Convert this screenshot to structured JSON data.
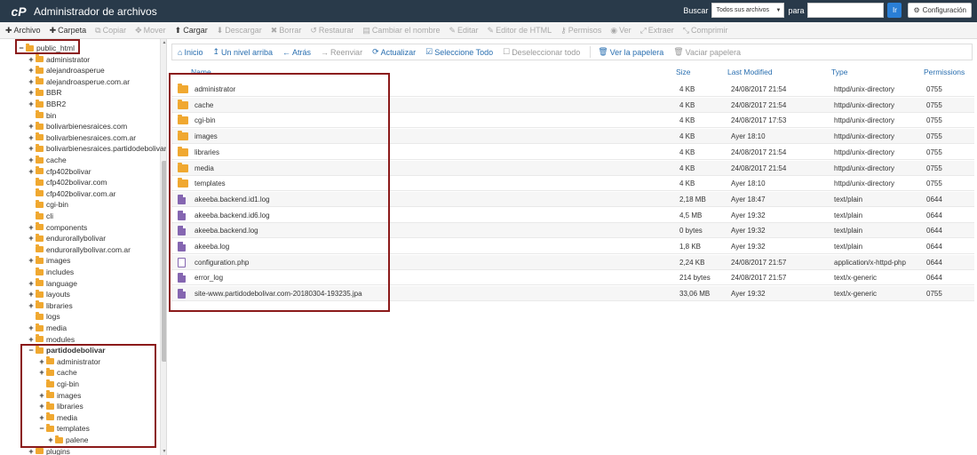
{
  "header": {
    "title": "Administrador de archivos",
    "search_label": "Buscar",
    "search_scope": "Todos sus archivos",
    "for_label": "para",
    "go_label": "Ir",
    "settings_label": "Configuración"
  },
  "toolbar": [
    {
      "label": "Archivo",
      "icon": "plus",
      "enabled": true
    },
    {
      "label": "Carpeta",
      "icon": "plus",
      "enabled": true
    },
    {
      "label": "Copiar",
      "icon": "copy",
      "enabled": false
    },
    {
      "label": "Mover",
      "icon": "move",
      "enabled": false
    },
    {
      "label": "Cargar",
      "icon": "upload",
      "enabled": true
    },
    {
      "label": "Descargar",
      "icon": "download",
      "enabled": false
    },
    {
      "label": "Borrar",
      "icon": "times",
      "enabled": false
    },
    {
      "label": "Restaurar",
      "icon": "undo",
      "enabled": false
    },
    {
      "label": "Cambiar el nombre",
      "icon": "file",
      "enabled": false
    },
    {
      "label": "Editar",
      "icon": "pencil",
      "enabled": false
    },
    {
      "label": "Editor de HTML",
      "icon": "pencil",
      "enabled": false
    },
    {
      "label": "Permisos",
      "icon": "key",
      "enabled": false
    },
    {
      "label": "Ver",
      "icon": "eye",
      "enabled": false
    },
    {
      "label": "Extraer",
      "icon": "expand",
      "enabled": false
    },
    {
      "label": "Comprimir",
      "icon": "compress",
      "enabled": false
    }
  ],
  "nav": [
    {
      "label": "Inicio",
      "icon": "home",
      "enabled": true
    },
    {
      "label": "Un nivel arriba",
      "icon": "level-up",
      "enabled": true
    },
    {
      "label": "Atrás",
      "icon": "arrow-left",
      "enabled": true
    },
    {
      "label": "Reenviar",
      "icon": "arrow-right",
      "enabled": false
    },
    {
      "label": "Actualizar",
      "icon": "refresh",
      "enabled": true
    },
    {
      "label": "Seleccione Todo",
      "icon": "check-square",
      "enabled": true
    },
    {
      "label": "Deseleccionar todo",
      "icon": "square",
      "enabled": false
    },
    {
      "label": "Ver la papelera",
      "icon": "trash",
      "enabled": true
    },
    {
      "label": "Vaciar papelera",
      "icon": "trash",
      "enabled": false
    }
  ],
  "tree": [
    {
      "label": "public_html",
      "toggle": "−",
      "indent": 1,
      "bold": false
    },
    {
      "label": "administrator",
      "toggle": "+",
      "indent": 2
    },
    {
      "label": "alejandroasperue",
      "toggle": "+",
      "indent": 2
    },
    {
      "label": "alejandroasperue.com.ar",
      "toggle": "+",
      "indent": 2
    },
    {
      "label": "BBR",
      "toggle": "+",
      "indent": 2
    },
    {
      "label": "BBR2",
      "toggle": "+",
      "indent": 2
    },
    {
      "label": "bin",
      "toggle": "",
      "indent": 2
    },
    {
      "label": "bolivarbienesraices.com",
      "toggle": "+",
      "indent": 2
    },
    {
      "label": "bolivarbienesraices.com.ar",
      "toggle": "+",
      "indent": 2
    },
    {
      "label": "bolivarbienesraices.partidodebolivar.",
      "toggle": "+",
      "indent": 2
    },
    {
      "label": "cache",
      "toggle": "+",
      "indent": 2
    },
    {
      "label": "cfp402bolivar",
      "toggle": "+",
      "indent": 2
    },
    {
      "label": "cfp402bolivar.com",
      "toggle": "",
      "indent": 2
    },
    {
      "label": "cfp402bolivar.com.ar",
      "toggle": "",
      "indent": 2
    },
    {
      "label": "cgi-bin",
      "toggle": "",
      "indent": 2
    },
    {
      "label": "cli",
      "toggle": "",
      "indent": 2
    },
    {
      "label": "components",
      "toggle": "+",
      "indent": 2
    },
    {
      "label": "endurorallybolivar",
      "toggle": "+",
      "indent": 2
    },
    {
      "label": "endurorallybolivar.com.ar",
      "toggle": "",
      "indent": 2
    },
    {
      "label": "images",
      "toggle": "+",
      "indent": 2
    },
    {
      "label": "includes",
      "toggle": "",
      "indent": 2
    },
    {
      "label": "language",
      "toggle": "+",
      "indent": 2
    },
    {
      "label": "layouts",
      "toggle": "+",
      "indent": 2
    },
    {
      "label": "libraries",
      "toggle": "+",
      "indent": 2
    },
    {
      "label": "logs",
      "toggle": "",
      "indent": 2
    },
    {
      "label": "media",
      "toggle": "+",
      "indent": 2
    },
    {
      "label": "modules",
      "toggle": "+",
      "indent": 2
    },
    {
      "label": "partidodebolivar",
      "toggle": "−",
      "indent": 2,
      "bold": true
    },
    {
      "label": "administrator",
      "toggle": "+",
      "indent": 3
    },
    {
      "label": "cache",
      "toggle": "+",
      "indent": 3
    },
    {
      "label": "cgi-bin",
      "toggle": "",
      "indent": 3
    },
    {
      "label": "images",
      "toggle": "+",
      "indent": 3
    },
    {
      "label": "libraries",
      "toggle": "+",
      "indent": 3
    },
    {
      "label": "media",
      "toggle": "+",
      "indent": 3
    },
    {
      "label": "templates",
      "toggle": "−",
      "indent": 3
    },
    {
      "label": "palene",
      "toggle": "+",
      "indent": 4
    },
    {
      "label": "plugins",
      "toggle": "+",
      "indent": 2
    }
  ],
  "columns": {
    "name": "Name",
    "size": "Size",
    "modified": "Last Modified",
    "type": "Type",
    "permissions": "Permissions"
  },
  "files": [
    {
      "name": "administrator",
      "kind": "folder",
      "size": "4 KB",
      "modified": "24/08/2017 21:54",
      "type": "httpd/unix-directory",
      "perms": "0755"
    },
    {
      "name": "cache",
      "kind": "folder",
      "size": "4 KB",
      "modified": "24/08/2017 21:54",
      "type": "httpd/unix-directory",
      "perms": "0755"
    },
    {
      "name": "cgi-bin",
      "kind": "folder",
      "size": "4 KB",
      "modified": "24/08/2017 17:53",
      "type": "httpd/unix-directory",
      "perms": "0755"
    },
    {
      "name": "images",
      "kind": "folder",
      "size": "4 KB",
      "modified": "Ayer 18:10",
      "type": "httpd/unix-directory",
      "perms": "0755"
    },
    {
      "name": "libraries",
      "kind": "folder",
      "size": "4 KB",
      "modified": "24/08/2017 21:54",
      "type": "httpd/unix-directory",
      "perms": "0755"
    },
    {
      "name": "media",
      "kind": "folder",
      "size": "4 KB",
      "modified": "24/08/2017 21:54",
      "type": "httpd/unix-directory",
      "perms": "0755"
    },
    {
      "name": "templates",
      "kind": "folder",
      "size": "4 KB",
      "modified": "Ayer 18:10",
      "type": "httpd/unix-directory",
      "perms": "0755"
    },
    {
      "name": "akeeba.backend.id1.log",
      "kind": "file",
      "size": "2,18 MB",
      "modified": "Ayer 18:47",
      "type": "text/plain",
      "perms": "0644"
    },
    {
      "name": "akeeba.backend.id6.log",
      "kind": "file",
      "size": "4,5 MB",
      "modified": "Ayer 19:32",
      "type": "text/plain",
      "perms": "0644"
    },
    {
      "name": "akeeba.backend.log",
      "kind": "file",
      "size": "0 bytes",
      "modified": "Ayer 19:32",
      "type": "text/plain",
      "perms": "0644"
    },
    {
      "name": "akeeba.log",
      "kind": "file",
      "size": "1,8 KB",
      "modified": "Ayer 19:32",
      "type": "text/plain",
      "perms": "0644"
    },
    {
      "name": "configuration.php",
      "kind": "code",
      "size": "2,24 KB",
      "modified": "24/08/2017 21:57",
      "type": "application/x-httpd-php",
      "perms": "0644"
    },
    {
      "name": "error_log",
      "kind": "file",
      "size": "214 bytes",
      "modified": "24/08/2017 21:57",
      "type": "text/x-generic",
      "perms": "0644"
    },
    {
      "name": "site-www.partidodebolivar.com-20180304-193235.jpa",
      "kind": "file",
      "size": "33,06 MB",
      "modified": "Ayer 19:32",
      "type": "text/x-generic",
      "perms": "0755"
    }
  ],
  "colors": {
    "header_bg": "#293a4a",
    "link": "#2a6fb0",
    "folder": "#f0a830",
    "file": "#8566b1",
    "highlight": "#8b1a1a"
  }
}
